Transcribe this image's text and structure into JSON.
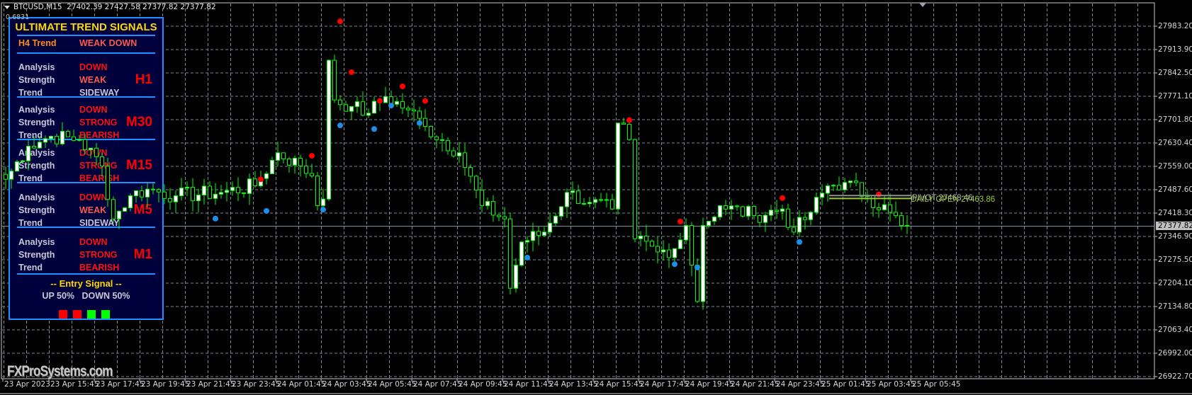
{
  "header": {
    "symbol": "BTCUSD,M15",
    "ohlc": "27402.39 27427.58 27377.82 27377.82",
    "indicator_value": "0.6831"
  },
  "panel": {
    "title": "ULTIMATE TREND SIGNALS",
    "h4": {
      "label": "H4 Trend",
      "value": "WEAK DOWN"
    },
    "sections": [
      {
        "tf": "H1",
        "analysis": "DOWN",
        "strength": "WEAK",
        "trend": "SIDEWAY"
      },
      {
        "tf": "M30",
        "analysis": "DOWN",
        "strength": "STRONG",
        "trend": "BEARISH"
      },
      {
        "tf": "M15",
        "analysis": "DOWN",
        "strength": "STRONG",
        "trend": "BEARISH"
      },
      {
        "tf": "M5",
        "analysis": "DOWN",
        "strength": "WEAK",
        "trend": "SIDEWAY"
      },
      {
        "tf": "M1",
        "analysis": "DOWN",
        "strength": "STRONG",
        "trend": "BEARISH"
      }
    ],
    "row_labels": {
      "analysis": "Analysis",
      "strength": "Strength",
      "trend": "Trend"
    },
    "entry_signal": "--  Entry Signal  --",
    "up": "UP 50%",
    "down": "DOWN 50%",
    "signal_squares": [
      "#ff0000",
      "#ff0000",
      "#00ff00",
      "#00ff00"
    ]
  },
  "colors": {
    "strong": "#ff1010",
    "weak": "#ff5a4a",
    "neutral": "#c8c8d8",
    "h4": "#ff8c1a",
    "candle": "#00ff00",
    "grid": "#7a8796",
    "sell_dot": "#ff0000",
    "buy_dot": "#1e8fe8"
  },
  "price_axis": [
    "27983.20",
    "27913.90",
    "27842.50",
    "27771.10",
    "27701.80",
    "27630.40",
    "27559.00",
    "27487.60",
    "27418.30",
    "27346.90",
    "27275.50",
    "27204.10",
    "27134.80",
    "27063.40",
    "26992.00",
    "26922.70"
  ],
  "current_price": "27377.82",
  "time_axis": [
    "23 Apr 2023",
    "23 Apr 15:45",
    "23 Apr 17:45",
    "23 Apr 19:45",
    "23 Apr 21:45",
    "23 Apr 23:45",
    "24 Apr 01:45",
    "24 Apr 03:45",
    "24 Apr 05:45",
    "24 Apr 07:45",
    "24 Apr 09:45",
    "24 Apr 11:45",
    "24 Apr 13:45",
    "24 Apr 15:45",
    "24 Apr 17:45",
    "24 Apr 19:45",
    "24 Apr 21:45",
    "24 Apr 23:45",
    "25 Apr 01:45",
    "25 Apr 03:45",
    "25 Apr 05:45"
  ],
  "pivot": {
    "label": "PIVOT 27468.46",
    "price": 27468.46
  },
  "daily_open": {
    "label": "DAILY OPEN 27463.86",
    "price": 27463.86
  },
  "watermark": "FXProSystems.com",
  "chart_data": {
    "type": "candlestick",
    "symbol": "BTCUSD",
    "timeframe": "M15",
    "ylim": [
      26922.7,
      27983.2
    ],
    "close_anchors": [
      [
        0,
        27520
      ],
      [
        4,
        27620
      ],
      [
        8,
        27650
      ],
      [
        13,
        27640
      ],
      [
        17,
        27560
      ],
      [
        19,
        27400
      ],
      [
        22,
        27470
      ],
      [
        25,
        27490
      ],
      [
        30,
        27470
      ],
      [
        38,
        27480
      ],
      [
        44,
        27500
      ],
      [
        48,
        27600
      ],
      [
        52,
        27560
      ],
      [
        54,
        27530
      ],
      [
        55,
        27440
      ],
      [
        56,
        27460
      ],
      [
        57,
        27880
      ],
      [
        58,
        27760
      ],
      [
        61,
        27740
      ],
      [
        64,
        27720
      ],
      [
        67,
        27770
      ],
      [
        71,
        27730
      ],
      [
        74,
        27680
      ],
      [
        80,
        27600
      ],
      [
        84,
        27440
      ],
      [
        88,
        27400
      ],
      [
        89,
        27190
      ],
      [
        91,
        27330
      ],
      [
        95,
        27360
      ],
      [
        99,
        27480
      ],
      [
        103,
        27450
      ],
      [
        107,
        27430
      ],
      [
        108,
        27690
      ],
      [
        110,
        27640
      ],
      [
        111,
        27340
      ],
      [
        115,
        27300
      ],
      [
        118,
        27310
      ],
      [
        120,
        27380
      ],
      [
        121,
        27260
      ],
      [
        122,
        27150
      ],
      [
        123,
        27380
      ],
      [
        126,
        27440
      ],
      [
        132,
        27410
      ],
      [
        137,
        27430
      ],
      [
        139,
        27360
      ],
      [
        142,
        27420
      ],
      [
        145,
        27500
      ],
      [
        148,
        27510
      ],
      [
        152,
        27470
      ],
      [
        156,
        27420
      ],
      [
        158,
        27380
      ],
      [
        159,
        27378
      ]
    ],
    "sell_signals": [
      [
        59,
        27998
      ],
      [
        61,
        27844
      ],
      [
        66,
        27757
      ],
      [
        70,
        27801
      ],
      [
        74,
        27757
      ],
      [
        54,
        27591
      ],
      [
        45,
        27520
      ],
      [
        110,
        27699
      ],
      [
        119,
        27392
      ],
      [
        137,
        27463
      ],
      [
        154,
        27474
      ]
    ],
    "buy_signals": [
      [
        37,
        27401
      ],
      [
        46,
        27424
      ],
      [
        56,
        27428
      ],
      [
        59,
        27683
      ],
      [
        65,
        27672
      ],
      [
        68,
        27743
      ],
      [
        73,
        27690
      ],
      [
        92,
        27283
      ],
      [
        118,
        27263
      ],
      [
        122,
        27253
      ],
      [
        140,
        27330
      ]
    ]
  }
}
